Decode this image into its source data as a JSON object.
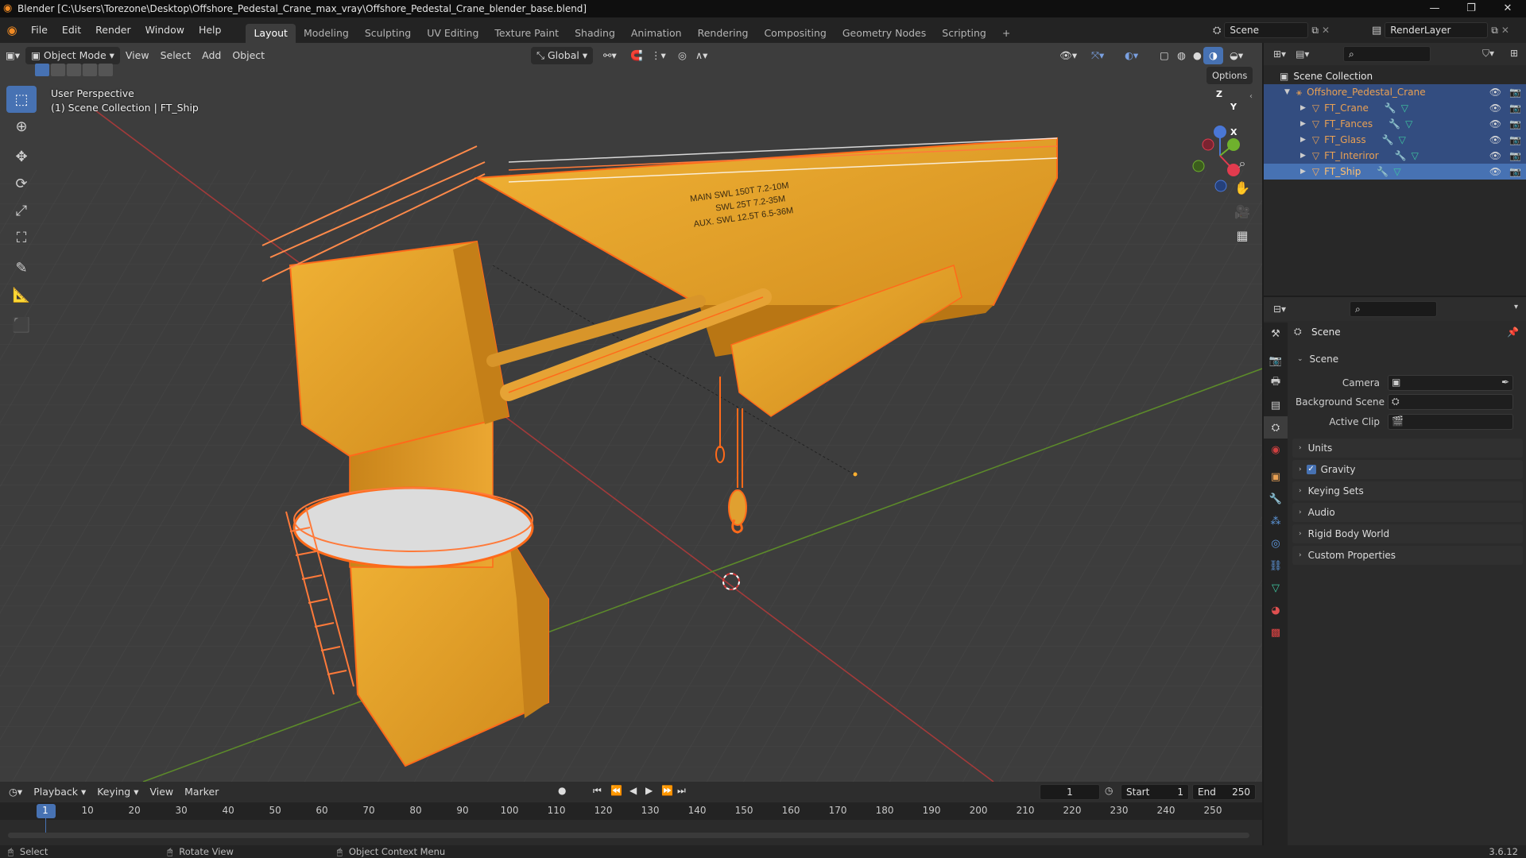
{
  "window": {
    "title": "Blender [C:\\Users\\Torezone\\Desktop\\Offshore_Pedestal_Crane_max_vray\\Offshore_Pedestal_Crane_blender_base.blend]",
    "minimize": "—",
    "maximize": "❐",
    "close": "✕"
  },
  "menu": [
    "File",
    "Edit",
    "Render",
    "Window",
    "Help"
  ],
  "workspaces": [
    "Layout",
    "Modeling",
    "Sculpting",
    "UV Editing",
    "Texture Paint",
    "Shading",
    "Animation",
    "Rendering",
    "Compositing",
    "Geometry Nodes",
    "Scripting"
  ],
  "workspace_add": "+",
  "scene_field": "Scene",
  "renderlayer_field": "RenderLayer",
  "viewport": {
    "mode": "Object Mode",
    "menus": [
      "View",
      "Select",
      "Add",
      "Object"
    ],
    "transform_orientation": "Global",
    "options": "Options",
    "overlay_line1": "User Perspective",
    "overlay_line2": "(1) Scene Collection | FT_Ship",
    "gizmo": {
      "x": "X",
      "y": "Y",
      "z": "Z"
    }
  },
  "crane_text": {
    "line1": "MAIN  SWL  150T 7.2-10M",
    "line2": "SWL   25T 7.2-35M",
    "line3": "AUX.  SWL  12.5T 6.5-36M"
  },
  "outliner": {
    "root": "Scene Collection",
    "collection": "Offshore_Pedestal_Crane",
    "items": [
      "FT_Crane",
      "FT_Fances",
      "FT_Glass",
      "FT_Interiror",
      "FT_Ship"
    ]
  },
  "properties": {
    "context": "Scene",
    "panel_scene": "Scene",
    "camera_label": "Camera",
    "background_scene_label": "Background Scene",
    "active_clip_label": "Active Clip",
    "collapsed_panels": [
      "Units",
      "Gravity",
      "Keying Sets",
      "Audio",
      "Rigid Body World",
      "Custom Properties"
    ],
    "gravity_checked": true
  },
  "timeline": {
    "menus": [
      "Playback",
      "Keying",
      "View",
      "Marker"
    ],
    "current_frame": "1",
    "start_label": "Start",
    "start_value": "1",
    "end_label": "End",
    "end_value": "250",
    "ticks": [
      "1",
      "10",
      "20",
      "30",
      "40",
      "50",
      "60",
      "70",
      "80",
      "90",
      "100",
      "110",
      "120",
      "130",
      "140",
      "150",
      "160",
      "170",
      "180",
      "190",
      "200",
      "210",
      "220",
      "230",
      "240",
      "250"
    ]
  },
  "status": {
    "select": "Select",
    "rotate": "Rotate View",
    "context_menu": "Object Context Menu",
    "version": "3.6.12"
  },
  "colors": {
    "selected_row": "#334d80",
    "active_tool": "#4772b3",
    "crane_body": "#e3a02a",
    "selection_outline": "#ff6a1a"
  }
}
